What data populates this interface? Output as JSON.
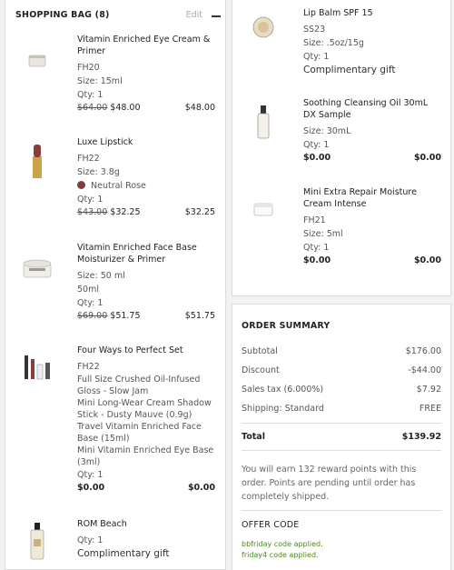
{
  "bag": {
    "title": "SHOPPING BAG (8)",
    "edit_label": "Edit",
    "items": [
      {
        "name": "Vitamin Enriched Eye Cream & Primer",
        "code": "FH20",
        "size": "Size: 15ml",
        "qty": "Qty: 1",
        "was": "$64.00",
        "now": "$48.00",
        "total": "$48.00"
      },
      {
        "name": "Luxe Lipstick",
        "code": "FH22",
        "size": "Size: 3.8g",
        "shade": "Neutral Rose",
        "qty": "Qty: 1",
        "was": "$43.00",
        "now": "$32.25",
        "total": "$32.25"
      },
      {
        "name": "Vitamin Enriched Face Base Moisturizer & Primer",
        "size": "Size: 50 ml",
        "size2": "50ml",
        "qty": "Qty: 1",
        "was": "$69.00",
        "now": "$51.75",
        "total": "$51.75"
      },
      {
        "name": "Four Ways to Perfect Set",
        "code": "FH22",
        "components": [
          "Full Size Crushed Oil-Infused Gloss - Slow Jam",
          "Mini Long-Wear Cream Shadow Stick - Dusty Mauve (0.9g)",
          "Travel Vitamin Enriched Face Base (15ml)",
          "Mini Vitamin Enriched Eye Base (3ml)"
        ],
        "qty": "Qty: 1",
        "now": "$0.00",
        "total": "$0.00"
      },
      {
        "name": "ROM Beach",
        "qty": "Qty: 1",
        "gift": "Complimentary gift"
      },
      {
        "name": "Lip Balm SPF 15",
        "code": "SS23",
        "size": "Size: .5oz/15g",
        "qty": "Qty: 1",
        "gift": "Complimentary gift"
      },
      {
        "name": "Soothing Cleansing Oil 30mL DX Sample",
        "size": "Size: 30mL",
        "qty": "Qty: 1",
        "now": "$0.00",
        "total": "$0.00"
      },
      {
        "name": "Mini Extra Repair Moisture Cream Intense",
        "code": "FH21",
        "size": "Size: 5ml",
        "qty": "Qty: 1",
        "now": "$0.00",
        "total": "$0.00"
      }
    ]
  },
  "summary": {
    "title": "ORDER SUMMARY",
    "subtotal_label": "Subtotal",
    "subtotal": "$176.00",
    "discount_label": "Discount",
    "discount": "-$44.00",
    "tax_label": "Sales tax (6.000%)",
    "tax": "$7.92",
    "shipping_label": "Shipping: Standard",
    "shipping": "FREE",
    "total_label": "Total",
    "total": "$139.92",
    "reward_text": "You will earn 132 reward points with this order. Points are pending until order has completely shipped.",
    "offer_title": "OFFER CODE",
    "codes": [
      "bbfriday code applied.",
      "friday4 code applied."
    ]
  },
  "colors": {
    "accent_green": "#4a8a1c",
    "swatch": "#7b3f3f"
  }
}
